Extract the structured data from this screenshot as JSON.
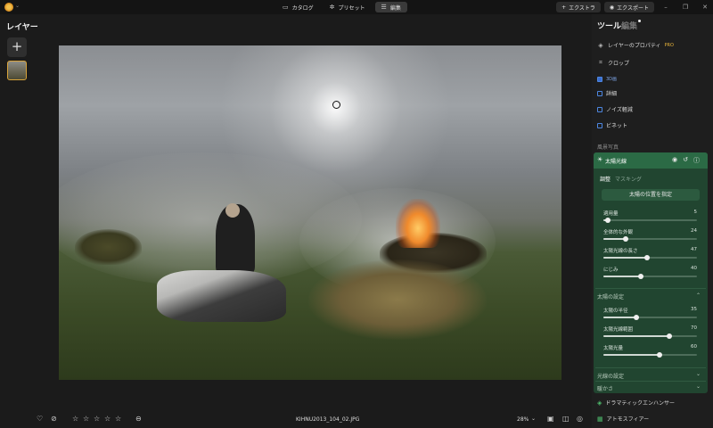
{
  "topbar": {
    "nav": [
      {
        "label": "カタログ",
        "icon": "folder-icon"
      },
      {
        "label": "プリセット",
        "icon": "sparkle-icon"
      },
      {
        "label": "編集",
        "icon": "sliders-icon"
      }
    ],
    "extras_label": "エクストラ",
    "export_label": "エクスポート"
  },
  "layers": {
    "title": "レイヤー"
  },
  "bottombar": {
    "filename": "KIHNU2013_104_02.JPG",
    "zoom": "28%"
  },
  "right_panel": {
    "tab_tools": "ツール",
    "tab_edits": "編集",
    "rows": [
      {
        "label": "レイヤーのプロパティ",
        "badge": "PRO",
        "icon": "layers-icon"
      },
      {
        "label": "クロップ",
        "icon": "crop-icon"
      },
      {
        "label": "詳細"
      },
      {
        "label": "ノイズ軽減"
      },
      {
        "label": "ビネット"
      }
    ],
    "clipped_label": "3D画",
    "section_label": "風景写真",
    "tool": {
      "title": "太陽光線",
      "subtab_adjust": "調整",
      "subtab_mask": "マスキング",
      "place_button": "太陽の位置を指定",
      "sliders": [
        {
          "label": "適用量",
          "value": 5
        },
        {
          "label": "全体的な外観",
          "value": 24
        },
        {
          "label": "太陽光線の長さ",
          "value": 47
        },
        {
          "label": "にじみ",
          "value": 40
        }
      ],
      "sun_settings_label": "太陽の設定",
      "sun_sliders": [
        {
          "label": "太陽の半径",
          "value": 35
        },
        {
          "label": "太陽光線範囲",
          "value": 70
        },
        {
          "label": "太陽光量",
          "value": 60
        }
      ],
      "ray_settings_label": "光線の設定",
      "warmth_label": "暖かさ"
    },
    "next_tools": [
      {
        "label": "ドラマティックエンハンサー"
      },
      {
        "label": "アトモスフィアー"
      }
    ]
  }
}
